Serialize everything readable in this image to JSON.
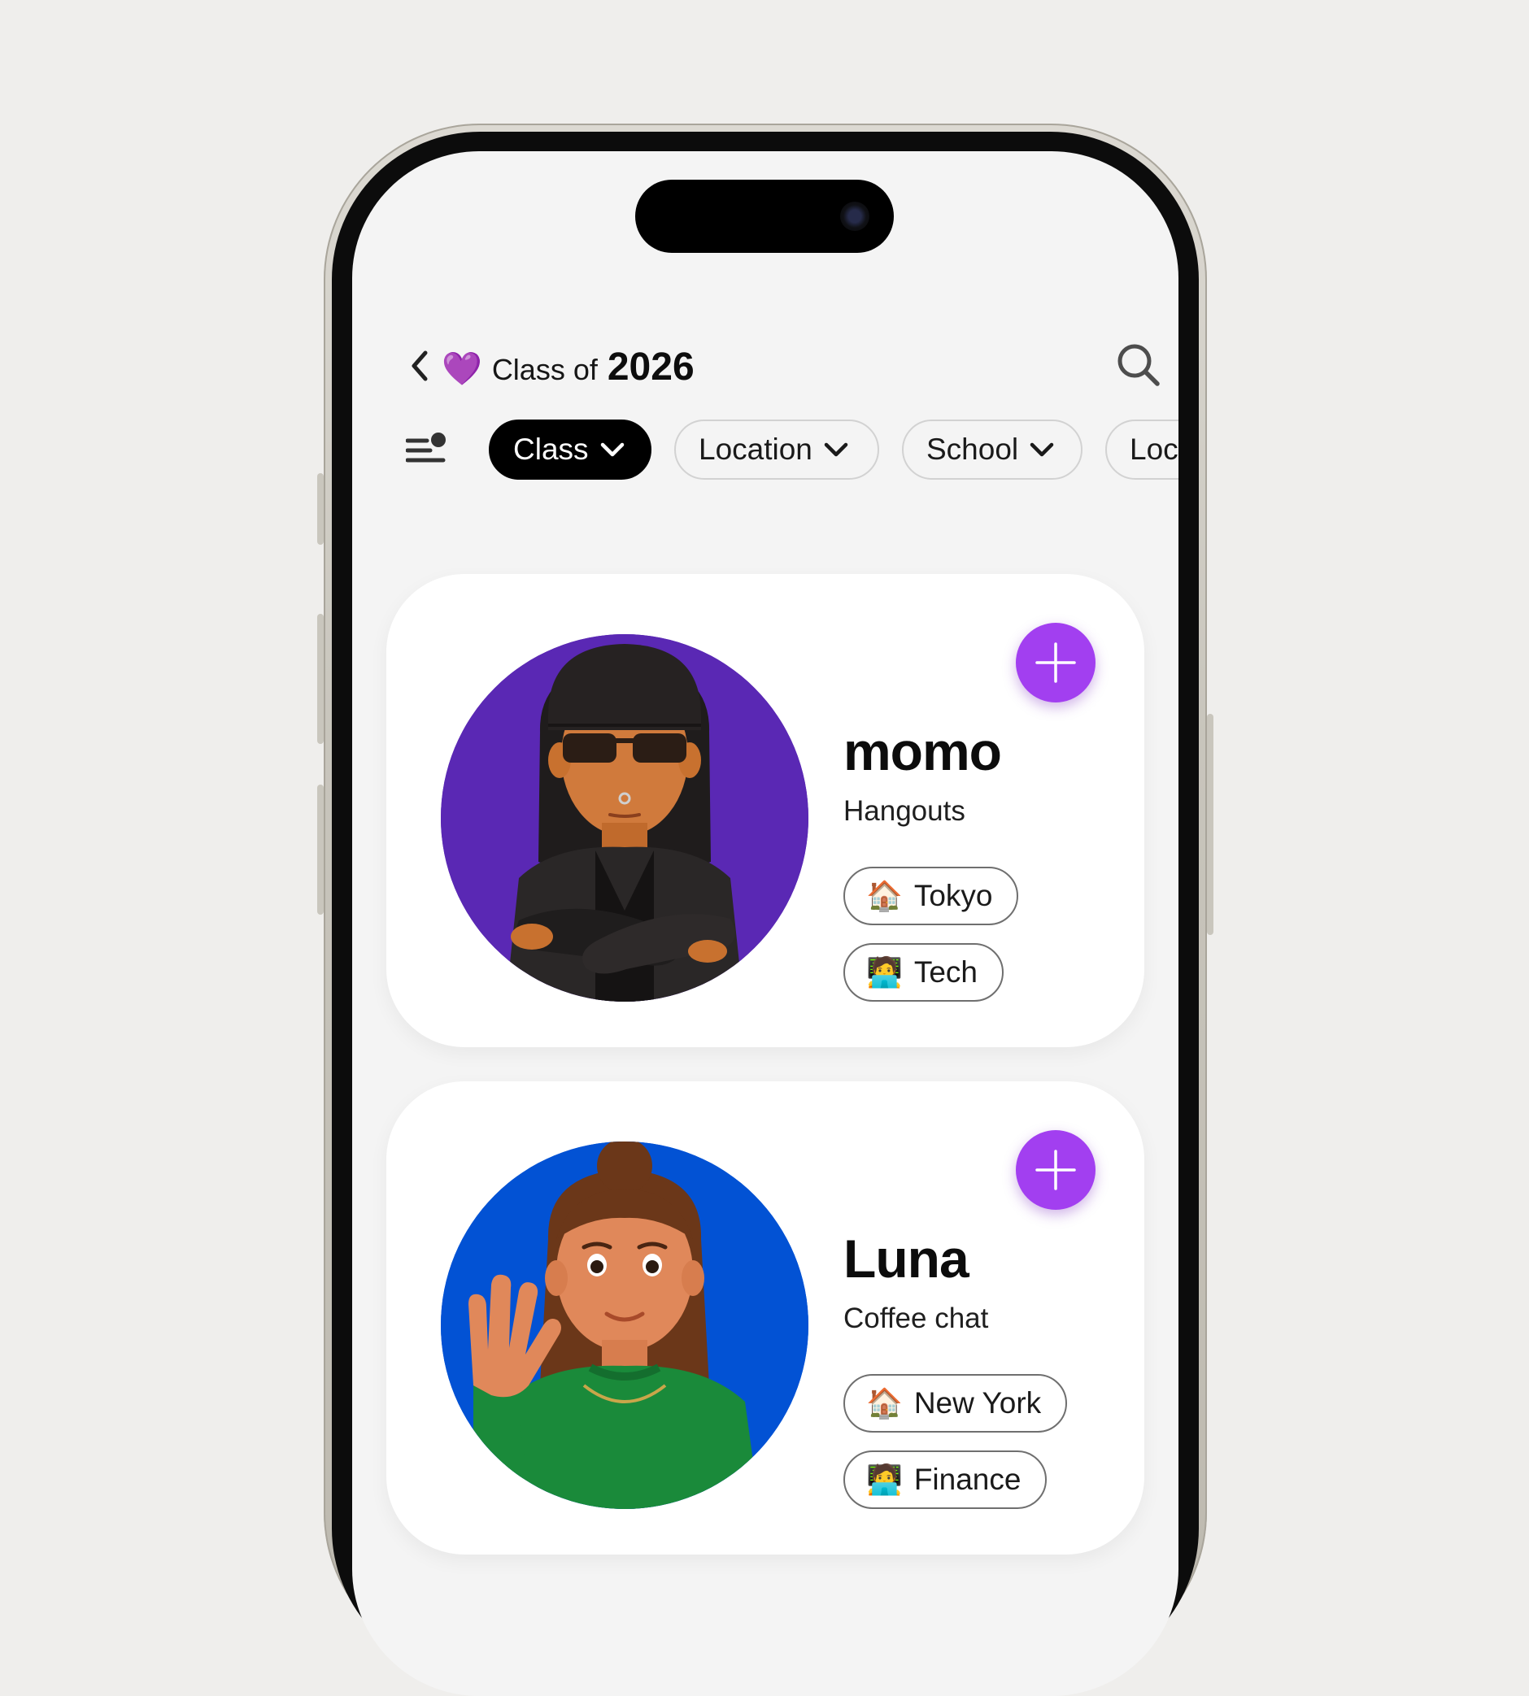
{
  "header": {
    "heart_emoji": "💜",
    "title_prefix": "Class of",
    "title_year": "2026",
    "back_icon": "chevron-left-icon",
    "search_icon": "search-icon"
  },
  "filters": {
    "menu_icon": "filter-people-icon",
    "chips": [
      {
        "label": "Class",
        "active": true
      },
      {
        "label": "Location",
        "active": false
      },
      {
        "label": "School",
        "active": false
      },
      {
        "label": "Loc",
        "active": false
      }
    ]
  },
  "people": [
    {
      "name": "momo",
      "purpose": "Hangouts",
      "avatar_bg": "#5a28b4",
      "tags": [
        {
          "emoji": "🏠",
          "label": "Tokyo"
        },
        {
          "emoji": "🧑‍💻",
          "label": "Tech"
        }
      ]
    },
    {
      "name": "Luna",
      "purpose": "Coffee chat",
      "avatar_bg": "#0252d4",
      "tags": [
        {
          "emoji": "🏠",
          "label": "New York"
        },
        {
          "emoji": "🧑‍💻",
          "label": "Finance"
        }
      ]
    }
  ],
  "colors": {
    "accent": "#a23ff0",
    "page_bg": "#efeeec",
    "screen_bg": "#f4f4f4"
  }
}
